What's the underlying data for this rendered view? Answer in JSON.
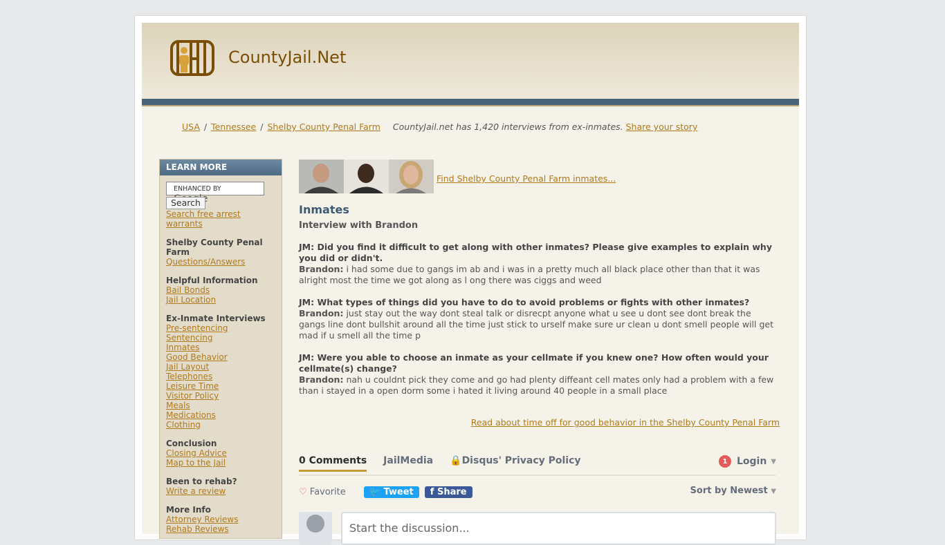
{
  "site": {
    "title": "CountyJail.Net"
  },
  "breadcrumb": {
    "items": [
      "USA",
      "Tennessee",
      "Shelby County Penal Farm"
    ],
    "note": "CountyJail.net has 1,420 interviews from ex-inmates.",
    "share_link": "Share your story"
  },
  "sidebar": {
    "header": "LEARN MORE",
    "google_label": "ENHANCED BY",
    "google_brand": "Google",
    "search_button": "Search",
    "warrants_link": "Search free arrest warrants",
    "groups": [
      {
        "title": "Shelby County Penal Farm",
        "links": [
          "Questions/Answers"
        ]
      },
      {
        "title": "Helpful Information",
        "links": [
          "Bail Bonds",
          "Jail Location"
        ]
      },
      {
        "title": "Ex-Inmate Interviews",
        "links": [
          "Pre-sentencing",
          "Sentencing",
          "Inmates",
          "Good Behavior",
          "Jail Layout",
          "Telephones",
          "Leisure Time",
          "Visitor Policy",
          "Meals",
          "Medications",
          "Clothing"
        ]
      },
      {
        "title": "Conclusion",
        "links": [
          "Closing Advice",
          "Map to the Jail"
        ]
      },
      {
        "title": "Been to rehab?",
        "links": [
          "Write a review"
        ]
      },
      {
        "title": "More Info",
        "links": [
          "Attorney Reviews",
          "Rehab Reviews"
        ]
      }
    ]
  },
  "main": {
    "find_link": "Find Shelby County Penal Farm inmates...",
    "heading": "Inmates",
    "subheading": "Interview with Brandon",
    "qa": [
      {
        "q": "JM: Did you find it difficult to get along with other inmates? Please give examples to explain why you did or didn't.",
        "speaker": "Brandon:",
        "a": "i had some due to gangs im ab and i was in a pretty much all black place other than that it was alright most the time we got along as l ong there was ciggs and weed"
      },
      {
        "q": "JM: What types of things did you have to do to avoid problems or fights with other inmates?",
        "speaker": "Brandon:",
        "a": "just stay out the way dont steal talk or disrecpt anyone what u see u dont see dont break the gangs line dont bullshit around all the time just stick to urself make sure ur clean u dont smell people will get mad if u smell all the time p"
      },
      {
        "q": "JM: Were you able to choose an inmate as your cellmate if you knew one? How often would your cellmate(s) change?",
        "speaker": "Brandon:",
        "a": "nah u couldnt pick they come and go had plenty diffeant cell mates only had a problem with a few than i stayed in a open dorm some i hated it living around 40 people in a small place"
      }
    ],
    "read_more": "Read about time off for good behavior in the Shelby County Penal Farm"
  },
  "disqus": {
    "tabs": [
      "0 Comments",
      "JailMedia",
      "Disqus' Privacy Policy"
    ],
    "login_badge": "1",
    "login": "Login",
    "favorite": "Favorite",
    "tweet": "Tweet",
    "share": "Share",
    "sort": "Sort by Newest",
    "compose_placeholder": "Start the discussion..."
  }
}
